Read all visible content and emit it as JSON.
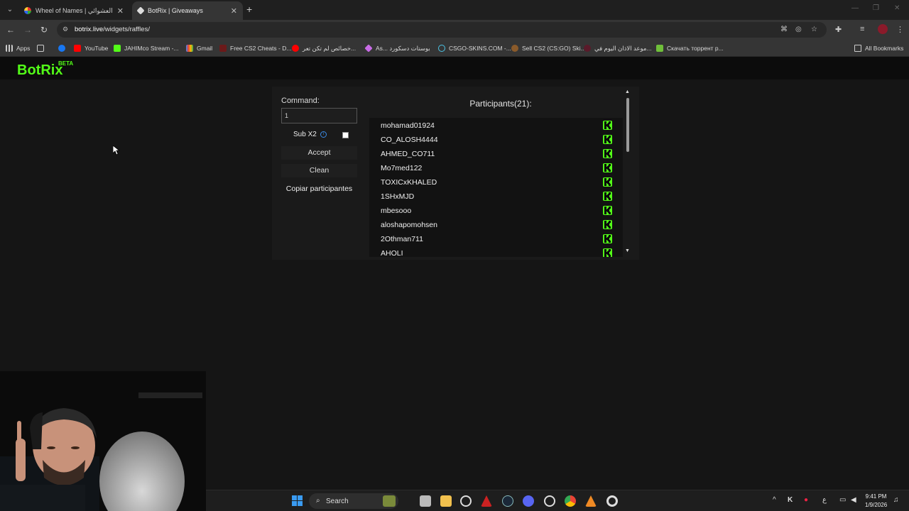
{
  "browser": {
    "tabs": [
      {
        "title": "Wheel of Names | اسم العشوائي",
        "active": false
      },
      {
        "title": "BotRix | Giveaways",
        "active": true
      }
    ],
    "url": {
      "host": "botrix.live",
      "path": "/widgets/raffles/"
    },
    "bookmarks": [
      {
        "label": "Apps",
        "icon": "apps-grid-icon"
      },
      {
        "label": "",
        "icon": "grid-icon"
      },
      {
        "label": "",
        "icon": "facebook-icon"
      },
      {
        "label": "YouTube",
        "icon": "youtube-icon"
      },
      {
        "label": "JAHIMco Stream -...",
        "icon": "kick-icon"
      },
      {
        "label": "Gmail",
        "icon": "gmail-icon"
      },
      {
        "label": "Free CS2 Cheats - D...",
        "icon": "cheats-icon"
      },
      {
        "label": "خصائص لم تكن تعر...",
        "icon": "youtube-icon"
      },
      {
        "label": "As... بوستات دسكورد",
        "icon": "diamond-icon"
      },
      {
        "label": "CSGO-SKINS.COM -...",
        "icon": "skins-icon"
      },
      {
        "label": "Sell CS2 (CS:GO) Ski...",
        "icon": "sell-icon"
      },
      {
        "label": "موعد الاذان اليوم في...",
        "icon": "prayer-icon"
      },
      {
        "label": "Скачать торрент р...",
        "icon": "torrent-icon"
      },
      {
        "label": "All Bookmarks",
        "icon": "folder-icon"
      }
    ]
  },
  "site": {
    "logo": "BotRix",
    "logo_badge": "BETA"
  },
  "raffle": {
    "command_label": "Command:",
    "command_value": "1",
    "sub_x2_label": "Sub X2",
    "sub_x2_checked": false,
    "accept_label": "Accept",
    "clean_label": "Clean",
    "copy_label": "Copiar participantes",
    "participants_header": "Participants(21):",
    "participants": [
      "mohamad01924",
      "CO_ALOSH4444",
      "AHMED_CO711",
      "Mo7med122",
      "TOXICxKHALED",
      "1SHxMJD",
      "mbesooo",
      "aloshapomohsen",
      "2Othman711",
      "AHOLI"
    ]
  },
  "taskbar": {
    "search_label": "Search",
    "time": "9:41 PM",
    "date": "1/9/2026",
    "lang": "ع"
  },
  "colors": {
    "kick_green": "#53fc18",
    "page_bg": "#151515",
    "panel_bg": "#1a1a1a"
  }
}
